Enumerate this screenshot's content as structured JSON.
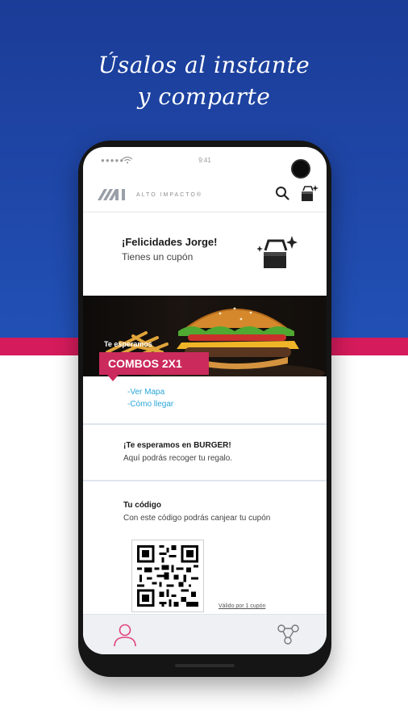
{
  "promo": {
    "line1": "Úsalos al instante",
    "line2": "y comparte"
  },
  "status_bar": {
    "time": "9:41",
    "signal": "●●●●●"
  },
  "app": {
    "brand": "ALTO IMPACTO®"
  },
  "greeting": {
    "title": "¡Felicidades Jorge!",
    "subtitle": "Tienes un cupón"
  },
  "promo_banner": {
    "wait_label": "Te esperamos",
    "offer": "COMBOS 2X1"
  },
  "links": [
    "-Ver Mapa",
    "-Cómo llegar"
  ],
  "store_section": {
    "title": "¡Te esperamos en BURGER!",
    "subtitle": "Aquí podrás recoger tu regalo."
  },
  "code_section": {
    "title": "Tu código",
    "subtitle": "Con este código podrás canjear tu cupón",
    "validity": "Válido por 1 cupón"
  },
  "bottom_nav": {
    "icons": [
      "user-icon",
      "share-icon"
    ]
  },
  "colors": {
    "brand_blue": "#1f47a8",
    "brand_pink": "#d51b5b",
    "ribbon": "#cb2a5d",
    "link": "#2aa7d8"
  }
}
